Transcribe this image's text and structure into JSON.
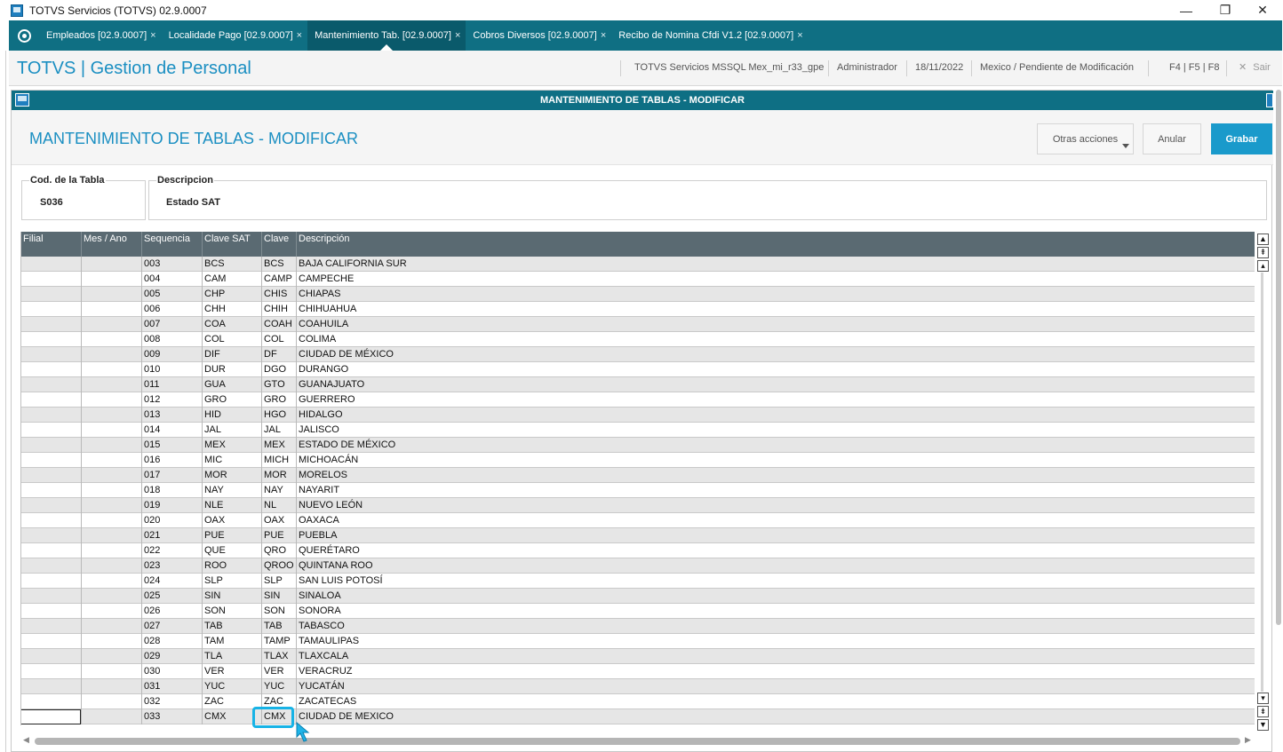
{
  "window": {
    "title": "TOTVS Servicios (TOTVS) 02.9.0007",
    "minimize": "—",
    "restore": "❐",
    "close": "✕"
  },
  "tabs": [
    {
      "label": "Empleados [02.9.0007]",
      "close": "×"
    },
    {
      "label": "Localidade Pago [02.9.0007]",
      "close": "×"
    },
    {
      "label": "Mantenimiento Tab. [02.9.0007]",
      "close": "×"
    },
    {
      "label": "Cobros Diversos [02.9.0007]",
      "close": "×"
    },
    {
      "label": "Recibo de Nomina Cfdi V1.2 [02.9.0007]",
      "close": "×"
    }
  ],
  "header": {
    "brand": "TOTVS | Gestion de Personal",
    "environment": "TOTVS Servicios MSSQL Mex_mi_r33_gpe",
    "user": "Administrador",
    "date": "18/11/2022",
    "branch": "Mexico / Pendiente de Modificación",
    "shortcuts": "F4 | F5 | F8",
    "exit": "Sair"
  },
  "dialog": {
    "title": "MANTENIMIENTO DE TABLAS - MODIFICAR",
    "page_title": "MANTENIMIENTO DE TABLAS - MODIFICAR",
    "buttons": {
      "other_actions": "Otras acciones",
      "cancel": "Anular",
      "save": "Grabar"
    },
    "fields": {
      "table_code_label": "Cod. de la Tabla",
      "table_code_value": "S036",
      "description_label": "Descripcion",
      "description_value": "Estado SAT"
    }
  },
  "grid": {
    "columns": [
      "Filial",
      "Mes / Ano",
      "Sequencia",
      "Clave SAT",
      "Clave",
      "Descripción"
    ],
    "rows": [
      [
        "",
        "",
        "003",
        "BCS",
        "BCS",
        "BAJA CALIFORNIA SUR"
      ],
      [
        "",
        "",
        "004",
        "CAM",
        "CAMP",
        "CAMPECHE"
      ],
      [
        "",
        "",
        "005",
        "CHP",
        "CHIS",
        "CHIAPAS"
      ],
      [
        "",
        "",
        "006",
        "CHH",
        "CHIH",
        "CHIHUAHUA"
      ],
      [
        "",
        "",
        "007",
        "COA",
        "COAH",
        "COAHUILA"
      ],
      [
        "",
        "",
        "008",
        "COL",
        "COL",
        "COLIMA"
      ],
      [
        "",
        "",
        "009",
        "DIF",
        "DF",
        "CIUDAD DE MÉXICO"
      ],
      [
        "",
        "",
        "010",
        "DUR",
        "DGO",
        "DURANGO"
      ],
      [
        "",
        "",
        "011",
        "GUA",
        "GTO",
        "GUANAJUATO"
      ],
      [
        "",
        "",
        "012",
        "GRO",
        "GRO",
        "GUERRERO"
      ],
      [
        "",
        "",
        "013",
        "HID",
        "HGO",
        "HIDALGO"
      ],
      [
        "",
        "",
        "014",
        "JAL",
        "JAL",
        "JALISCO"
      ],
      [
        "",
        "",
        "015",
        "MEX",
        "MEX",
        "ESTADO DE MÉXICO"
      ],
      [
        "",
        "",
        "016",
        "MIC",
        "MICH",
        "MICHOACÁN"
      ],
      [
        "",
        "",
        "017",
        "MOR",
        "MOR",
        "MORELOS"
      ],
      [
        "",
        "",
        "018",
        "NAY",
        "NAY",
        "NAYARIT"
      ],
      [
        "",
        "",
        "019",
        "NLE",
        "NL",
        "NUEVO LEÓN"
      ],
      [
        "",
        "",
        "020",
        "OAX",
        "OAX",
        "OAXACA"
      ],
      [
        "",
        "",
        "021",
        "PUE",
        "PUE",
        "PUEBLA"
      ],
      [
        "",
        "",
        "022",
        "QUE",
        "QRO",
        "QUERÉTARO"
      ],
      [
        "",
        "",
        "023",
        "ROO",
        "QROO",
        "QUINTANA ROO"
      ],
      [
        "",
        "",
        "024",
        "SLP",
        "SLP",
        "SAN LUIS POTOSÍ"
      ],
      [
        "",
        "",
        "025",
        "SIN",
        "SIN",
        "SINALOA"
      ],
      [
        "",
        "",
        "026",
        "SON",
        "SON",
        "SONORA"
      ],
      [
        "",
        "",
        "027",
        "TAB",
        "TAB",
        "TABASCO"
      ],
      [
        "",
        "",
        "028",
        "TAM",
        "TAMP",
        "TAMAULIPAS"
      ],
      [
        "",
        "",
        "029",
        "TLA",
        "TLAX",
        "TLAXCALA"
      ],
      [
        "",
        "",
        "030",
        "VER",
        "VER",
        "VERACRUZ"
      ],
      [
        "",
        "",
        "031",
        "YUC",
        "YUC",
        "YUCATÁN"
      ],
      [
        "",
        "",
        "032",
        "ZAC",
        "ZAC",
        "ZACATECAS"
      ],
      [
        "",
        "",
        "033",
        "CMX",
        "CMX",
        "CIUDAD DE MEXICO"
      ]
    ],
    "selected_row": 30
  },
  "colors": {
    "tabstrip": "#0f6f83",
    "brand": "#1b8fc2",
    "primary_button": "#1a9acb",
    "grid_header": "#5a6a72",
    "highlight": "#17b3e6"
  },
  "icons": {
    "home": "refresh-ring-icon",
    "cursor": "mouse-pointer-icon"
  }
}
